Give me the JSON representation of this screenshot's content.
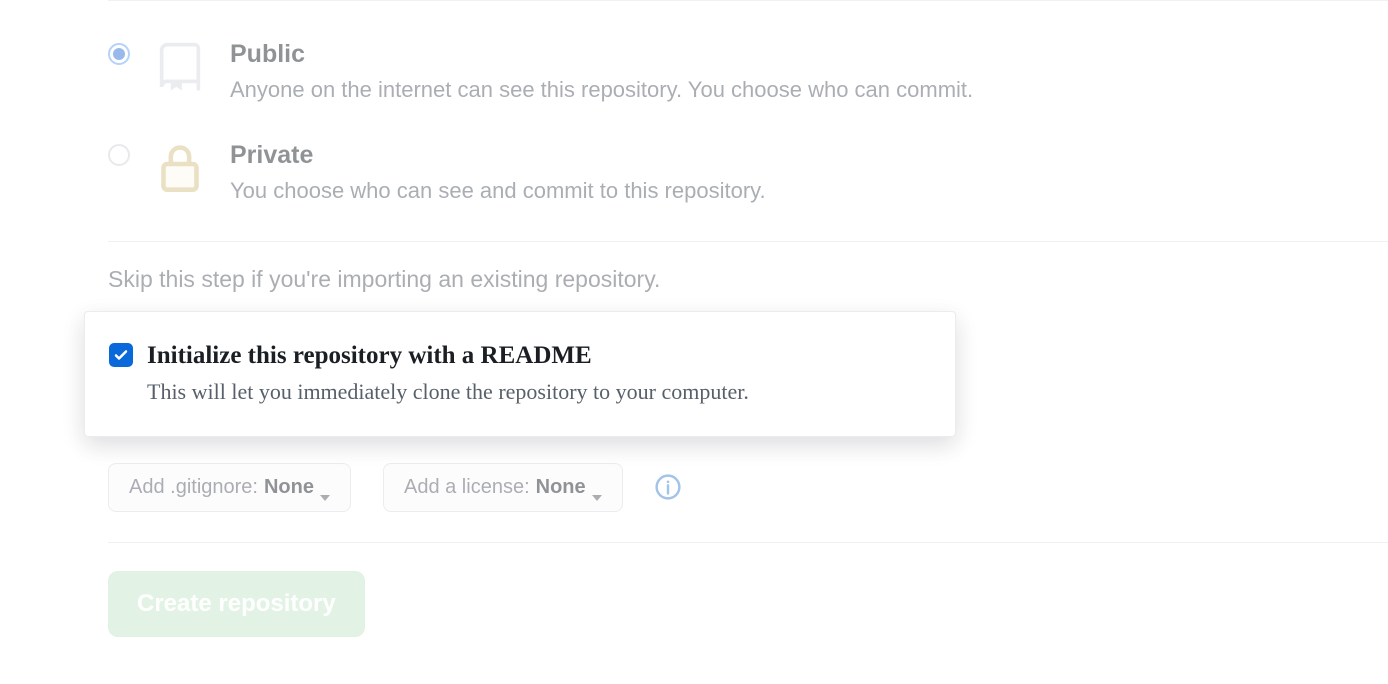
{
  "visibility": {
    "public": {
      "title": "Public",
      "description": "Anyone on the internet can see this repository. You choose who can commit.",
      "checked": true
    },
    "private": {
      "title": "Private",
      "description": "You choose who can see and commit to this repository.",
      "checked": false
    }
  },
  "initialize": {
    "skip_text": "Skip this step if you're importing an existing repository.",
    "readme_title": "Initialize this repository with a README",
    "readme_description": "This will let you immediately clone the repository to your computer.",
    "readme_checked": true
  },
  "options": {
    "gitignore_label": "Add .gitignore:",
    "gitignore_value": "None",
    "license_label": "Add a license:",
    "license_value": "None"
  },
  "submit": {
    "label": "Create repository"
  }
}
